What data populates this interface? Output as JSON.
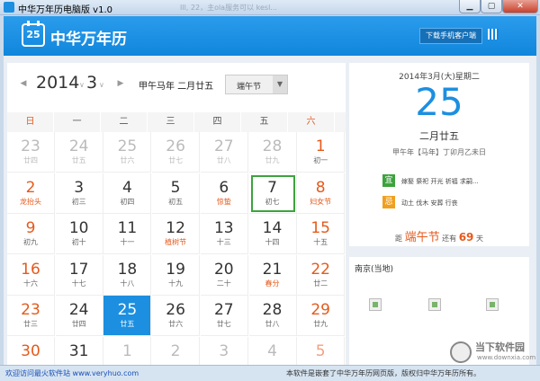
{
  "window": {
    "title": "中华万年历电脑版 v1.0",
    "faded_title": "Ill, 22，主ola服务可以 kesl...",
    "min_label": "▁",
    "max_label": "▢",
    "close_label": "✕"
  },
  "header": {
    "logo_icon_text": "25",
    "logo_text": "中华万年历",
    "download_label": "下载手机客户端",
    "qr_icon": "qr-code-icon"
  },
  "calendar": {
    "year": "2014",
    "month": "3",
    "prev_arrow": "◀",
    "next_arrow": "▶",
    "dropdown_arrow": "∨",
    "lunar_year": "甲午马年 二月廿五",
    "festival_select": "端午节",
    "weekdays": [
      "日",
      "一",
      "二",
      "三",
      "四",
      "五",
      "六"
    ],
    "days": [
      {
        "d": "23",
        "l": "廿四",
        "other": true,
        "wkend": false
      },
      {
        "d": "24",
        "l": "廿五",
        "other": true,
        "wkend": false
      },
      {
        "d": "25",
        "l": "廿六",
        "other": true,
        "wkend": false
      },
      {
        "d": "26",
        "l": "廿七",
        "other": true,
        "wkend": false
      },
      {
        "d": "27",
        "l": "廿八",
        "other": true,
        "wkend": false
      },
      {
        "d": "28",
        "l": "廿九",
        "other": true,
        "wkend": false
      },
      {
        "d": "1",
        "l": "初一",
        "wkend": true
      },
      {
        "d": "2",
        "l": "龙抬头",
        "fest": true,
        "wkend": true
      },
      {
        "d": "3",
        "l": "初三"
      },
      {
        "d": "4",
        "l": "初四"
      },
      {
        "d": "5",
        "l": "初五"
      },
      {
        "d": "6",
        "l": "惊蛰",
        "fest": true
      },
      {
        "d": "7",
        "l": "初七",
        "today": true
      },
      {
        "d": "8",
        "l": "妇女节",
        "fest": true,
        "wkend": true
      },
      {
        "d": "9",
        "l": "初九",
        "wkend": true
      },
      {
        "d": "10",
        "l": "初十"
      },
      {
        "d": "11",
        "l": "十一"
      },
      {
        "d": "12",
        "l": "植树节",
        "fest": true
      },
      {
        "d": "13",
        "l": "十三"
      },
      {
        "d": "14",
        "l": "十四"
      },
      {
        "d": "15",
        "l": "十五",
        "wkend": true
      },
      {
        "d": "16",
        "l": "十六",
        "wkend": true
      },
      {
        "d": "17",
        "l": "十七"
      },
      {
        "d": "18",
        "l": "十八"
      },
      {
        "d": "19",
        "l": "十九"
      },
      {
        "d": "20",
        "l": "二十"
      },
      {
        "d": "21",
        "l": "春分",
        "fest": true
      },
      {
        "d": "22",
        "l": "廿二",
        "wkend": true
      },
      {
        "d": "23",
        "l": "廿三",
        "wkend": true
      },
      {
        "d": "24",
        "l": "廿四"
      },
      {
        "d": "25",
        "l": "廿五",
        "selected": true
      },
      {
        "d": "26",
        "l": "廿六"
      },
      {
        "d": "27",
        "l": "廿七"
      },
      {
        "d": "28",
        "l": "廿八"
      },
      {
        "d": "29",
        "l": "廿九",
        "wkend": true
      },
      {
        "d": "30",
        "l": "",
        "wkend": true
      },
      {
        "d": "31",
        "l": ""
      },
      {
        "d": "1",
        "l": "",
        "other": true
      },
      {
        "d": "2",
        "l": "",
        "other": true
      },
      {
        "d": "3",
        "l": "",
        "other": true
      },
      {
        "d": "4",
        "l": "",
        "other": true
      },
      {
        "d": "5",
        "l": "",
        "other": true,
        "wkend": true
      }
    ]
  },
  "detail": {
    "date_line": "2014年3月(大)星期二",
    "day": "25",
    "lunar": "二月廿五",
    "ganzhi": "甲午年【马年】丁卯月乙未日",
    "yi_label": "宜",
    "yi_text": "嫁娶 祭祀 开光 祈福 求嗣...",
    "ji_label": "忌",
    "ji_text": "动土 伐木 安葬 行丧",
    "countdown_pre": "距",
    "countdown_fest": "端午节",
    "countdown_mid": "还有",
    "countdown_num": "69",
    "countdown_unit": "天"
  },
  "weather": {
    "city": "南京(当地)",
    "icons": [
      "weather-image-icon",
      "weather-image-icon",
      "weather-image-icon"
    ]
  },
  "statusbar": {
    "left": "欢迎访问最火软件站 www.veryhuo.com",
    "right": "本软件是嵌套了中华万年历网页版，版权归中华万年历所有。"
  },
  "watermark": {
    "text": "当下软件园",
    "sub": "www.downxia.com"
  }
}
